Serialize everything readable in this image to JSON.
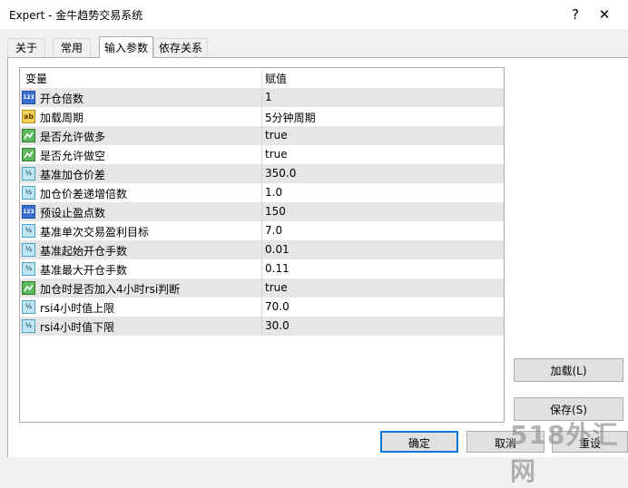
{
  "window": {
    "title": "Expert - 金牛趋势交易系统",
    "help_glyph": "?",
    "close_glyph": "✕"
  },
  "tabs": [
    {
      "label": "关于"
    },
    {
      "label": "常用"
    },
    {
      "label": "输入参数"
    },
    {
      "label": "依存关系"
    }
  ],
  "active_tab": "输入参数",
  "grid": {
    "col_variable": "变量",
    "col_value": "赋值",
    "rows": [
      {
        "name": "开仓倍数",
        "value": "1",
        "type": "int",
        "icon": "int-type-icon"
      },
      {
        "name": "加载周期",
        "value": "5分钟周期",
        "type": "string",
        "icon": "string-type-icon"
      },
      {
        "name": "是否允许做多",
        "value": "true",
        "type": "bool",
        "icon": "bool-type-icon"
      },
      {
        "name": "是否允许做空",
        "value": "true",
        "type": "bool",
        "icon": "bool-type-icon"
      },
      {
        "name": "基准加仓价差",
        "value": "350.0",
        "type": "double",
        "icon": "double-type-icon"
      },
      {
        "name": "加仓价差递增倍数",
        "value": "1.0",
        "type": "double",
        "icon": "double-type-icon"
      },
      {
        "name": "预设止盈点数",
        "value": "150",
        "type": "int",
        "icon": "int-type-icon"
      },
      {
        "name": "基准单次交易盈利目标",
        "value": "7.0",
        "type": "double",
        "icon": "double-type-icon"
      },
      {
        "name": "基准起始开仓手数",
        "value": "0.01",
        "type": "double",
        "icon": "double-type-icon"
      },
      {
        "name": "基准最大开仓手数",
        "value": "0.11",
        "type": "double",
        "icon": "double-type-icon"
      },
      {
        "name": "加仓时是否加入4小时rsi判断",
        "value": "true",
        "type": "bool",
        "icon": "bool-type-icon"
      },
      {
        "name": "rsi4小时值上限",
        "value": "70.0",
        "type": "double",
        "icon": "double-type-icon"
      },
      {
        "name": "rsi4小时值下限",
        "value": "30.0",
        "type": "double",
        "icon": "double-type-icon"
      }
    ]
  },
  "icon_text": {
    "int": "123",
    "string": "ab",
    "double": "½"
  },
  "buttons": {
    "load": "加载(L)",
    "save": "保存(S)",
    "ok": "确定",
    "cancel": "取消",
    "reset": "重设"
  },
  "watermark": "518外汇网"
}
